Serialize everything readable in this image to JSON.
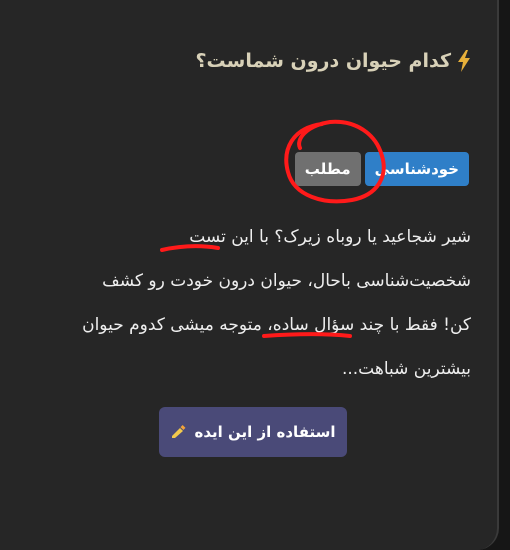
{
  "card": {
    "title": "کدام حیوان درون شماست؟",
    "title_icon": "lightning-bolt-icon",
    "tags": [
      {
        "label": "خودشناسی",
        "color": "#2f7fc8"
      },
      {
        "label": "مطلب",
        "color": "#707070"
      }
    ],
    "description_lines": [
      "شیر شجاعید یا روباه زیرک؟ با این تست",
      "شخصیت‌شناسی باحال، حیوان درون خودت رو کشف",
      "کن! فقط با چند سؤال ساده، متوجه میشی کدوم حیوان",
      "بیشترین شباهت..."
    ],
    "cta": {
      "label": "استفاده از این ایده",
      "icon": "writing-hand-icon",
      "color": "#4a4a78"
    }
  },
  "annotations": {
    "color": "#ff1a1a"
  }
}
